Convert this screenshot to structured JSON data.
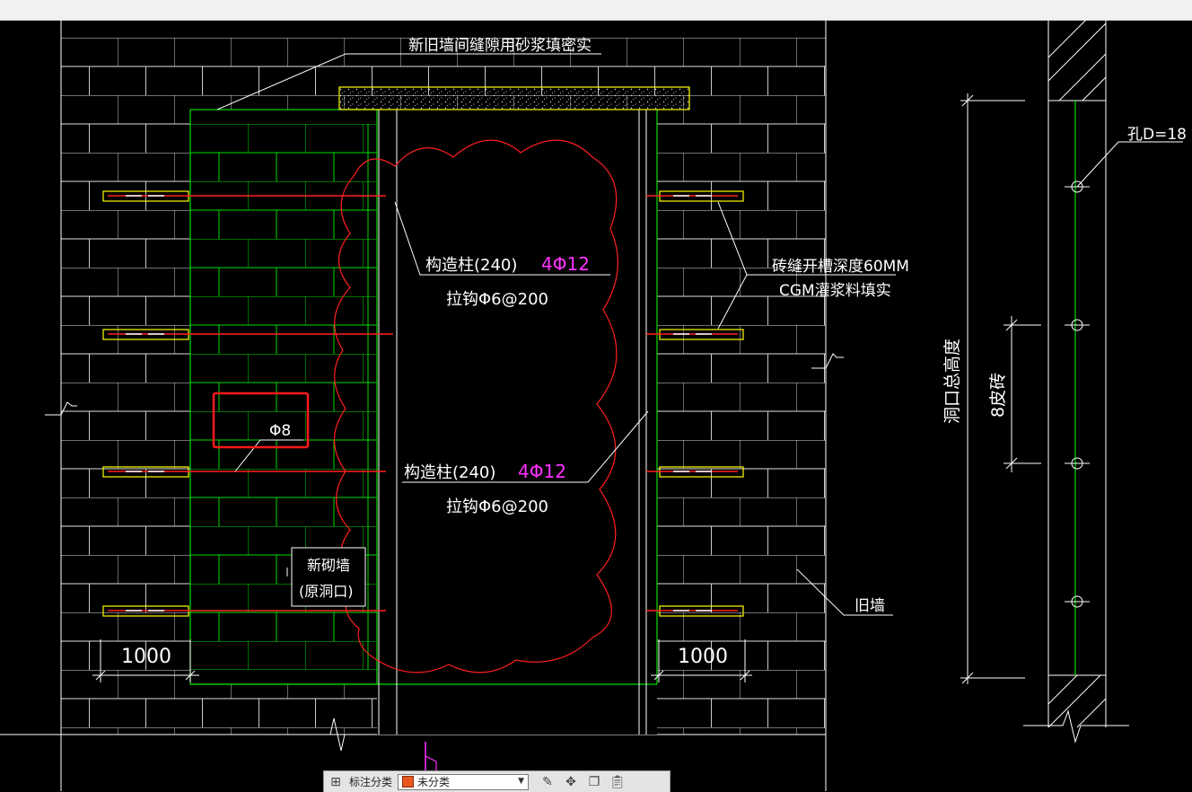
{
  "colors": {
    "background": "#000000",
    "old_wall_lines": "#ffffff",
    "new_wall_lines": "#00dd00",
    "revision_cloud": "#ff2020",
    "rebar": "#ff2020",
    "anchor_outline": "#ffff00",
    "rebar_spec": "#ff33ff",
    "highlight_box": "#ff1a1a"
  },
  "annotations": {
    "gap_fill_note": "新旧墙间缝隙用砂浆填密实",
    "column_upper": "构造柱(240)",
    "column_upper_rebar": "4Φ12",
    "column_upper_tie": "拉钩Φ6@200",
    "column_lower": "构造柱(240)",
    "column_lower_rebar": "4Φ12",
    "column_lower_tie": "拉钩Φ6@200",
    "groove_line1": "砖缝开槽深度60MM",
    "groove_line2": "CGM灌浆料填实",
    "bar_dia": "Φ8",
    "new_wall_line1": "新砌墙",
    "new_wall_line2": "(原洞口)",
    "old_wall": "旧墙",
    "dim_left": "1000",
    "dim_right": "1000",
    "opening_height": "洞口总高度",
    "brick_courses": "8皮砖",
    "hole_dia": "孔D=18"
  },
  "toolbar": {
    "grid_icon": "four-squares-icon",
    "label": "标注分类",
    "select_value": "未分类",
    "tools": [
      "edit-icon",
      "move-icon",
      "copy-icon",
      "paste-icon"
    ]
  }
}
